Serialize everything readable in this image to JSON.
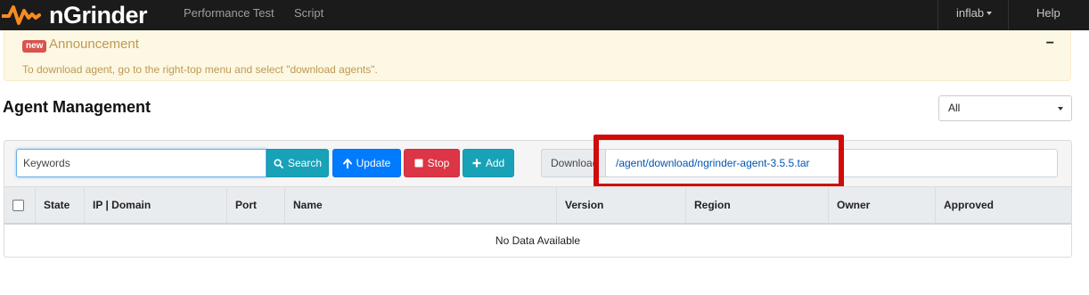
{
  "navbar": {
    "brand": "nGrinder",
    "links": [
      "Performance Test",
      "Script"
    ],
    "user": "inflab",
    "help": "Help"
  },
  "announcement": {
    "badge": "new",
    "title": "Announcement",
    "toggle": "−",
    "text": "To download agent, go to the right-top menu and select \"download agents\"."
  },
  "page": {
    "title": "Agent Management",
    "region_select": "All"
  },
  "toolbar": {
    "search_placeholder": "Keywords",
    "search_label": "Search",
    "update_label": "Update",
    "stop_label": "Stop",
    "add_label": "Add",
    "download_label": "Download",
    "download_link": "/agent/download/ngrinder-agent-3.5.5.tar"
  },
  "table": {
    "columns": [
      "State",
      "IP | Domain",
      "Port",
      "Name",
      "Version",
      "Region",
      "Owner",
      "Approved"
    ],
    "empty_text": "No Data Available"
  },
  "colors": {
    "info": "#17a2b8",
    "primary": "#007bff",
    "danger": "#dc3545",
    "highlight": "#d20a0a",
    "brand_orange": "#f68b1f"
  }
}
